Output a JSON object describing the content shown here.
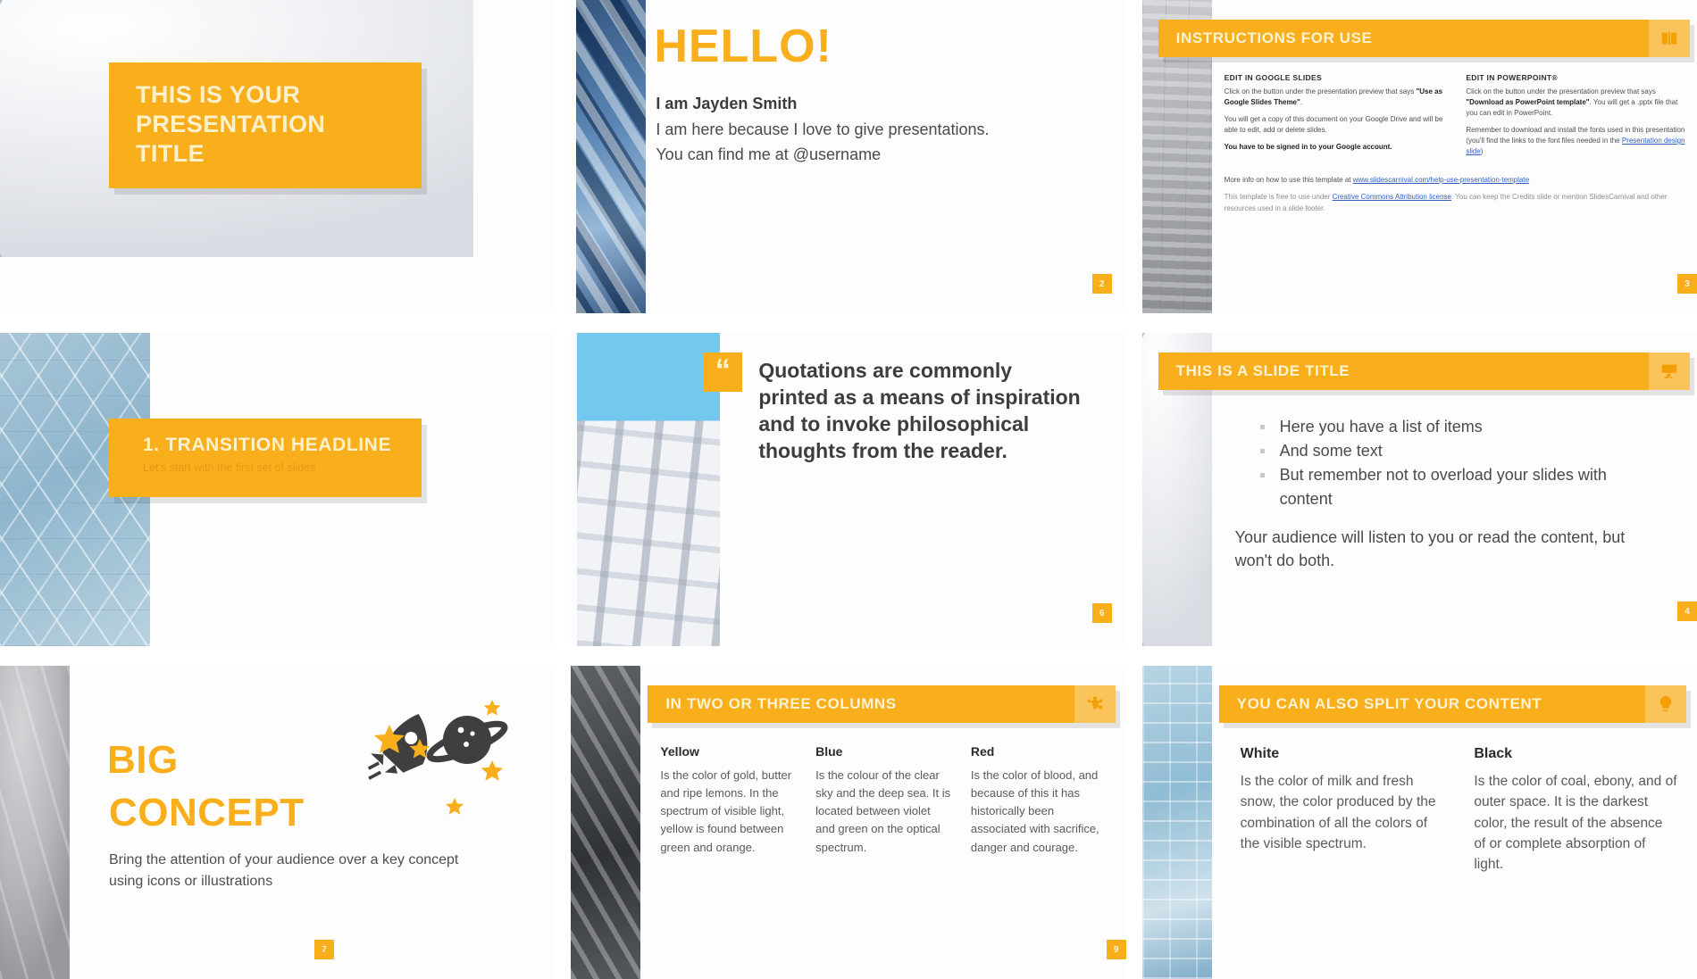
{
  "theme": {
    "accent": "#f9ae1b",
    "accent_text": "#fdf0cd",
    "body_text": "#4a4a4a"
  },
  "slides": [
    {
      "id": "title-slide",
      "title_lines": [
        "THIS IS YOUR",
        "PRESENTATION",
        "TITLE"
      ],
      "page": ""
    },
    {
      "id": "hello-slide",
      "heading": "HELLO!",
      "name": "I am Jayden Smith",
      "line1": "I am here because I love to give presentations.",
      "line2": "You can find me at @username",
      "page": "2"
    },
    {
      "id": "instructions-slide",
      "bar_title": "INSTRUCTIONS FOR USE",
      "bar_icon": "book-icon",
      "left": {
        "heading": "EDIT IN GOOGLE SLIDES",
        "p1_a": "Click on the button under the presentation preview that says ",
        "p1_b": "\"Use as Google Slides Theme\"",
        "p1_c": ".",
        "p2": "You will get a copy of this document on your Google Drive and will be able to edit, add or delete slides.",
        "p3": "You have to be signed in to your Google account."
      },
      "right": {
        "heading": "EDIT IN POWERPOINT®",
        "p1_a": "Click on the button under the presentation preview that says ",
        "p1_b": "\"Download as PowerPoint template\"",
        "p1_c": ". You will get a .pptx file that you can edit in PowerPoint.",
        "p2_a": "Remember to download and install the fonts used in this presentation (you'll find the links to the font files needed in the ",
        "p2_link": "Presentation design slide",
        "p2_c": ")"
      },
      "footer": {
        "line1_a": "More info on how to use this template at ",
        "line1_link": "www.slidescarnival.com/help-use-presentation-template",
        "line2_a": "This template is free to use under ",
        "line2_link": "Creative Commons Attribution license",
        "line2_c": ". You can keep the Credits slide or mention SlidesCarnival and other resources used in a slide footer."
      },
      "page": "3"
    },
    {
      "id": "transition-slide",
      "headline": "1. TRANSITION HEADLINE",
      "subtext": "Let's start with the first set of slides",
      "page": ""
    },
    {
      "id": "quotation-slide",
      "quote_mark": "“",
      "quote": "Quotations are commonly printed as a means of inspiration and to invoke philosophical thoughts from the reader.",
      "page": "6"
    },
    {
      "id": "slide-title-list",
      "bar_title": "THIS IS A SLIDE TITLE",
      "bar_icon": "presentation-icon",
      "bullets": [
        "Here you have a list of items",
        "And some text",
        "But remember not to overload your slides with content"
      ],
      "paragraph": "Your audience will listen to you or read the content, but won't do both.",
      "page": "4"
    },
    {
      "id": "big-concept-slide",
      "line1": "BIG",
      "line2": "CONCEPT",
      "subtitle": "Bring the attention of your audience over a key concept using icons or illustrations",
      "illustration": [
        "rocket-icon",
        "planet-icon",
        "star-icon"
      ],
      "page": "7"
    },
    {
      "id": "columns-slide",
      "bar_title": "IN TWO OR THREE COLUMNS",
      "bar_icon": "puzzle-icon",
      "columns": [
        {
          "heading": "Yellow",
          "body": "Is the color of gold, butter and ripe lemons. In the spectrum of visible light, yellow is found between green and orange."
        },
        {
          "heading": "Blue",
          "body": "Is the colour of the clear sky and the deep sea. It is located between violet and green on the optical spectrum."
        },
        {
          "heading": "Red",
          "body": "Is the color of blood, and because of this it has historically been associated with sacrifice, danger and courage."
        }
      ],
      "page": "9"
    },
    {
      "id": "split-content-slide",
      "bar_title": "YOU CAN ALSO SPLIT YOUR CONTENT",
      "bar_icon": "lightbulb-icon",
      "columns": [
        {
          "heading": "White",
          "body": "Is the color of milk and fresh snow, the color produced by the combination of all the colors of the visible spectrum."
        },
        {
          "heading": "Black",
          "body": "Is the color of coal, ebony, and of outer space. It is the darkest color, the result of the absence of or complete absorption of light."
        }
      ],
      "page": ""
    }
  ]
}
